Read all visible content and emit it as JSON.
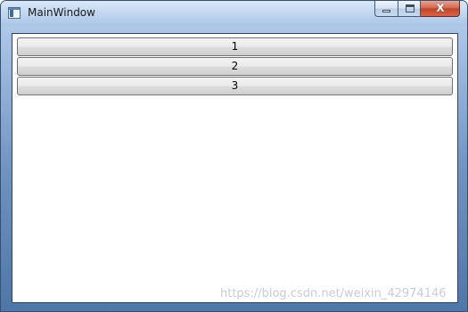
{
  "window": {
    "title": "MainWindow",
    "icon": "wpf-app-icon",
    "caption_buttons": {
      "minimize": "minimize-icon",
      "maximize": "maximize-icon",
      "close_glyph": "X"
    }
  },
  "buttons": [
    {
      "label": "1"
    },
    {
      "label": "2"
    },
    {
      "label": "3"
    }
  ],
  "watermark": "https://blog.csdn.net/weixin_42974146"
}
